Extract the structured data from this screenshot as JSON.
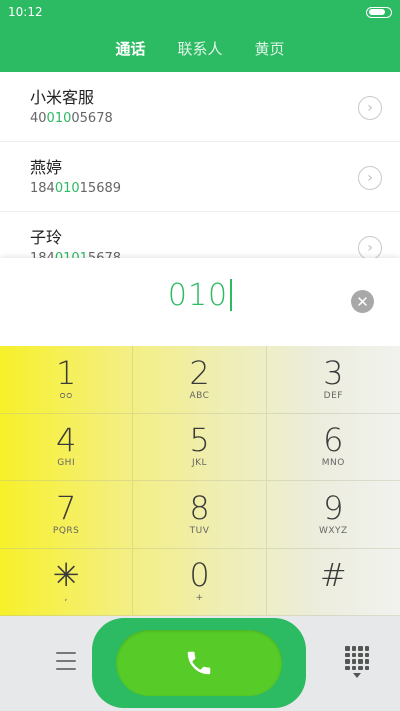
{
  "status": {
    "time": "10:12",
    "battery_level": 0.85
  },
  "tabs": [
    {
      "label": "通话",
      "active": true
    },
    {
      "label": "联系人",
      "active": false
    },
    {
      "label": "黄页",
      "active": false
    }
  ],
  "contacts": [
    {
      "name": "小米客服",
      "num_pre": "40",
      "num_hl": "010",
      "num_post": "05678"
    },
    {
      "name": "燕婷",
      "num_pre": "184",
      "num_hl": "010",
      "num_post": "15689"
    },
    {
      "name": "子玲",
      "num_pre": "184",
      "num_hl": "0101",
      "num_post": "5678"
    }
  ],
  "entry": {
    "digits": "010",
    "clear_glyph": "✕"
  },
  "keys": [
    {
      "digit": "1",
      "letters": "ᴑᴑ"
    },
    {
      "digit": "2",
      "letters": "ABC"
    },
    {
      "digit": "3",
      "letters": "DEF"
    },
    {
      "digit": "4",
      "letters": "GHI"
    },
    {
      "digit": "5",
      "letters": "JKL"
    },
    {
      "digit": "6",
      "letters": "MNO"
    },
    {
      "digit": "7",
      "letters": "PQRS"
    },
    {
      "digit": "8",
      "letters": "TUV"
    },
    {
      "digit": "9",
      "letters": "WXYZ"
    },
    {
      "digit": "✳",
      "letters": ","
    },
    {
      "digit": "0",
      "letters": "+"
    },
    {
      "digit": "#",
      "letters": ""
    }
  ],
  "colors": {
    "accent": "#2cba62",
    "call": "#57cc28"
  },
  "icons": {
    "chevron": "chevron-right-icon",
    "menu": "menu-icon",
    "call": "phone-icon",
    "dialpad": "dialpad-icon"
  }
}
